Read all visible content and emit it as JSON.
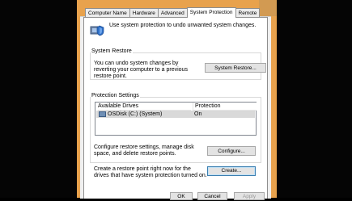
{
  "tabs": [
    "Computer Name",
    "Hardware",
    "Advanced",
    "System Protection",
    "Remote"
  ],
  "active_tab": "System Protection",
  "intro_text": "Use system protection to undo unwanted system changes.",
  "system_restore": {
    "group_label": "System Restore",
    "description": "You can undo system changes by reverting your computer to a previous restore point.",
    "button_label": "System Restore..."
  },
  "protection_settings": {
    "group_label": "Protection Settings",
    "columns": [
      "Available Drives",
      "Protection"
    ],
    "rows": [
      {
        "drive": "OSDisk (C:) (System)",
        "protection": "On"
      }
    ],
    "configure_text": "Configure restore settings, manage disk space, and delete restore points.",
    "configure_button": "Configure...",
    "create_text": "Create a restore point right now for the drives that have system protection turned on.",
    "create_button": "Create..."
  },
  "footer": {
    "ok": "OK",
    "cancel": "Cancel",
    "apply": "Apply"
  },
  "colors": {
    "frame": "#e8a24d",
    "selected_row": "#d9d9d9",
    "button_focus": "#3c7fb1"
  }
}
